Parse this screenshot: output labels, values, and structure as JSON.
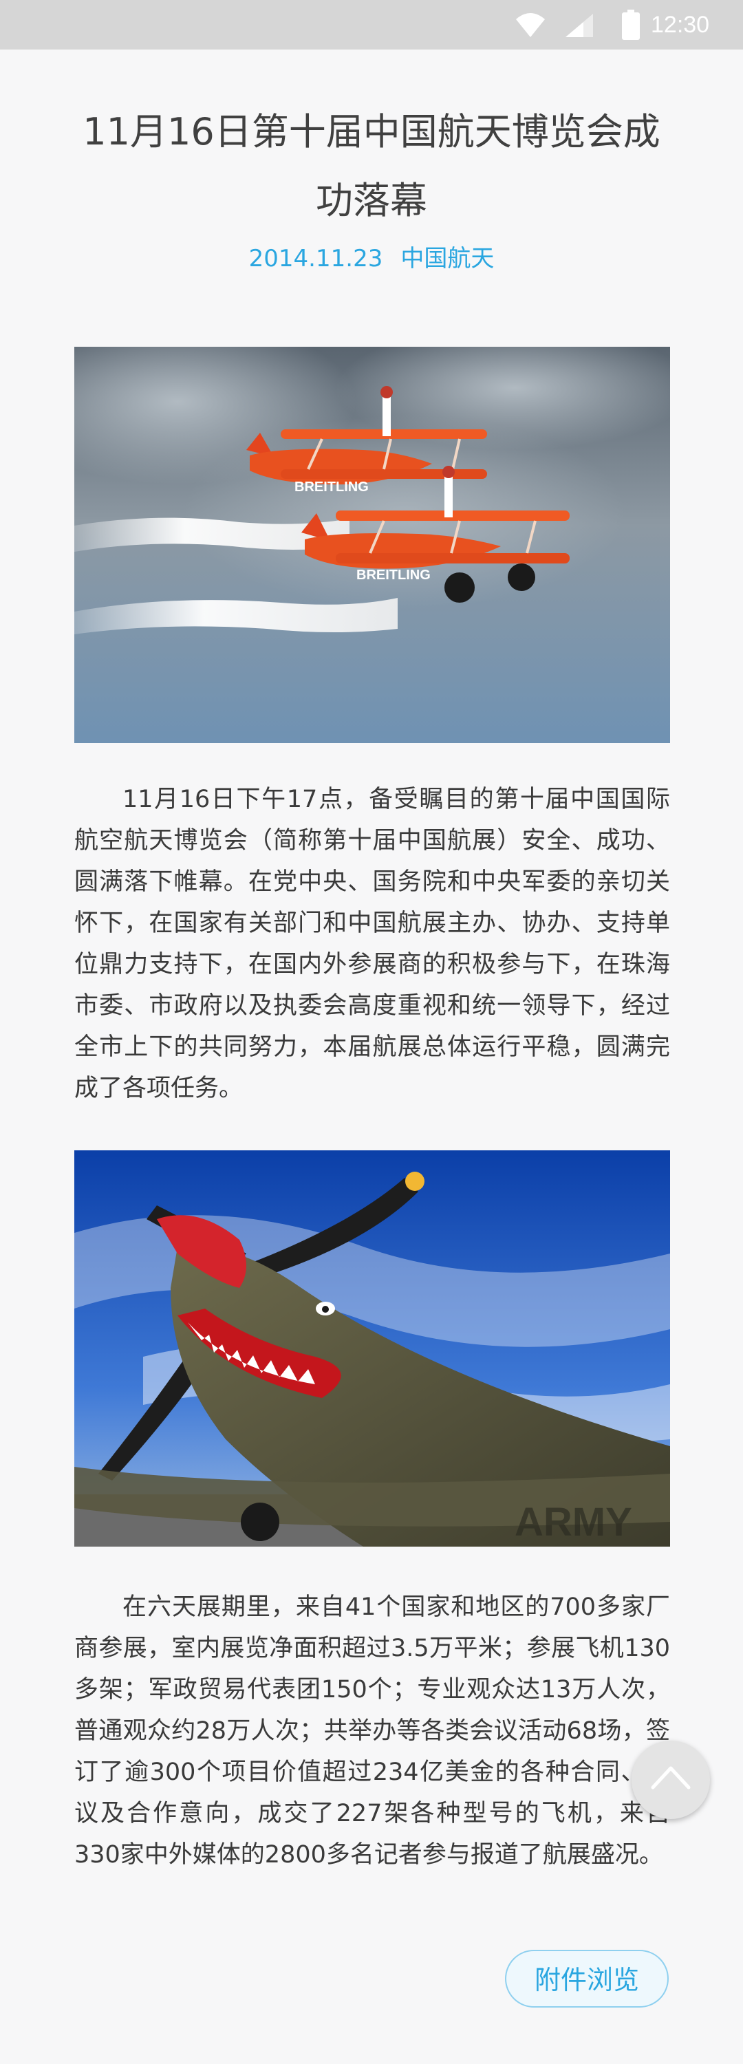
{
  "status_bar": {
    "time": "12:30",
    "icons": [
      "wifi-icon",
      "signal-icon",
      "battery-icon"
    ]
  },
  "article": {
    "title": "11月16日第十届中国航天博览会成功落幕",
    "date": "2014.11.23",
    "source": "中国航天",
    "paragraphs": [
      "11月16日下午17点，备受瞩目的第十届中国国际航空航天博览会（简称第十届中国航展）安全、成功、圆满落下帷幕。在党中央、国务院和中央军委的亲切关怀下，在国家有关部门和中国航展主办、协办、支持单位鼎力支持下，在国内外参展商的积极参与下，在珠海市委、市政府以及执委会高度重视和统一领导下，经过全市上下的共同努力，本届航展总体运行平稳，圆满完成了各项任务。",
      "在六天展期里，来自41个国家和地区的700多家厂商参展，室内展览净面积超过3.5万平米；参展飞机130多架；军政贸易代表团150个；专业观众达13万人次，普通观众约28万人次；共举办等各类会议活动68场，签订了逾300个项目价值超过234亿美金的各种合同、协议及合作意向，成交了227架各种型号的飞机，来自330家中外媒体的2800多名记者参与报道了航展盛况。"
    ],
    "images": [
      {
        "name": "aerobatic-biplanes-photo",
        "label": "BREITLING"
      },
      {
        "name": "shark-mouth-warbird-photo",
        "label": "ARMY"
      }
    ],
    "attachment_button": "附件浏览"
  },
  "floating": {
    "scroll_top_icon": "chevron-up-icon"
  },
  "colors": {
    "accent": "#2aa6e0",
    "status_bar": "#d6d6d6",
    "background": "#f7f7f8"
  }
}
